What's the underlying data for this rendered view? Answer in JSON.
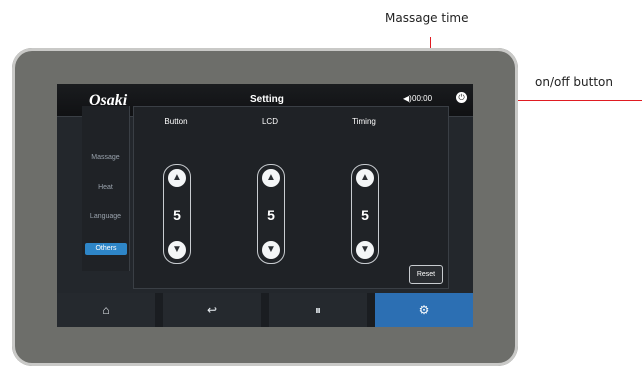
{
  "annotations": {
    "massage_time": "Massage time",
    "on_off": "on/off button"
  },
  "screen": {
    "header": {
      "logo": "Osaki",
      "title": "Setting",
      "timer": "00:00"
    },
    "menu": {
      "items": [
        "Massage",
        "Heat",
        "Language"
      ],
      "active": "Others"
    },
    "panel": {
      "columns": [
        {
          "label": "Button",
          "value": "5"
        },
        {
          "label": "LCD",
          "value": "5"
        },
        {
          "label": "Timing",
          "value": "5"
        }
      ],
      "reset_label": "Reset"
    },
    "bottom_nav": [
      {
        "icon": "home-icon"
      },
      {
        "icon": "back-icon"
      },
      {
        "icon": "pause-icon"
      },
      {
        "icon": "gear-icon"
      }
    ]
  },
  "colors": {
    "accent_blue": "#2e86c8",
    "annotation_red": "#e01b22"
  }
}
